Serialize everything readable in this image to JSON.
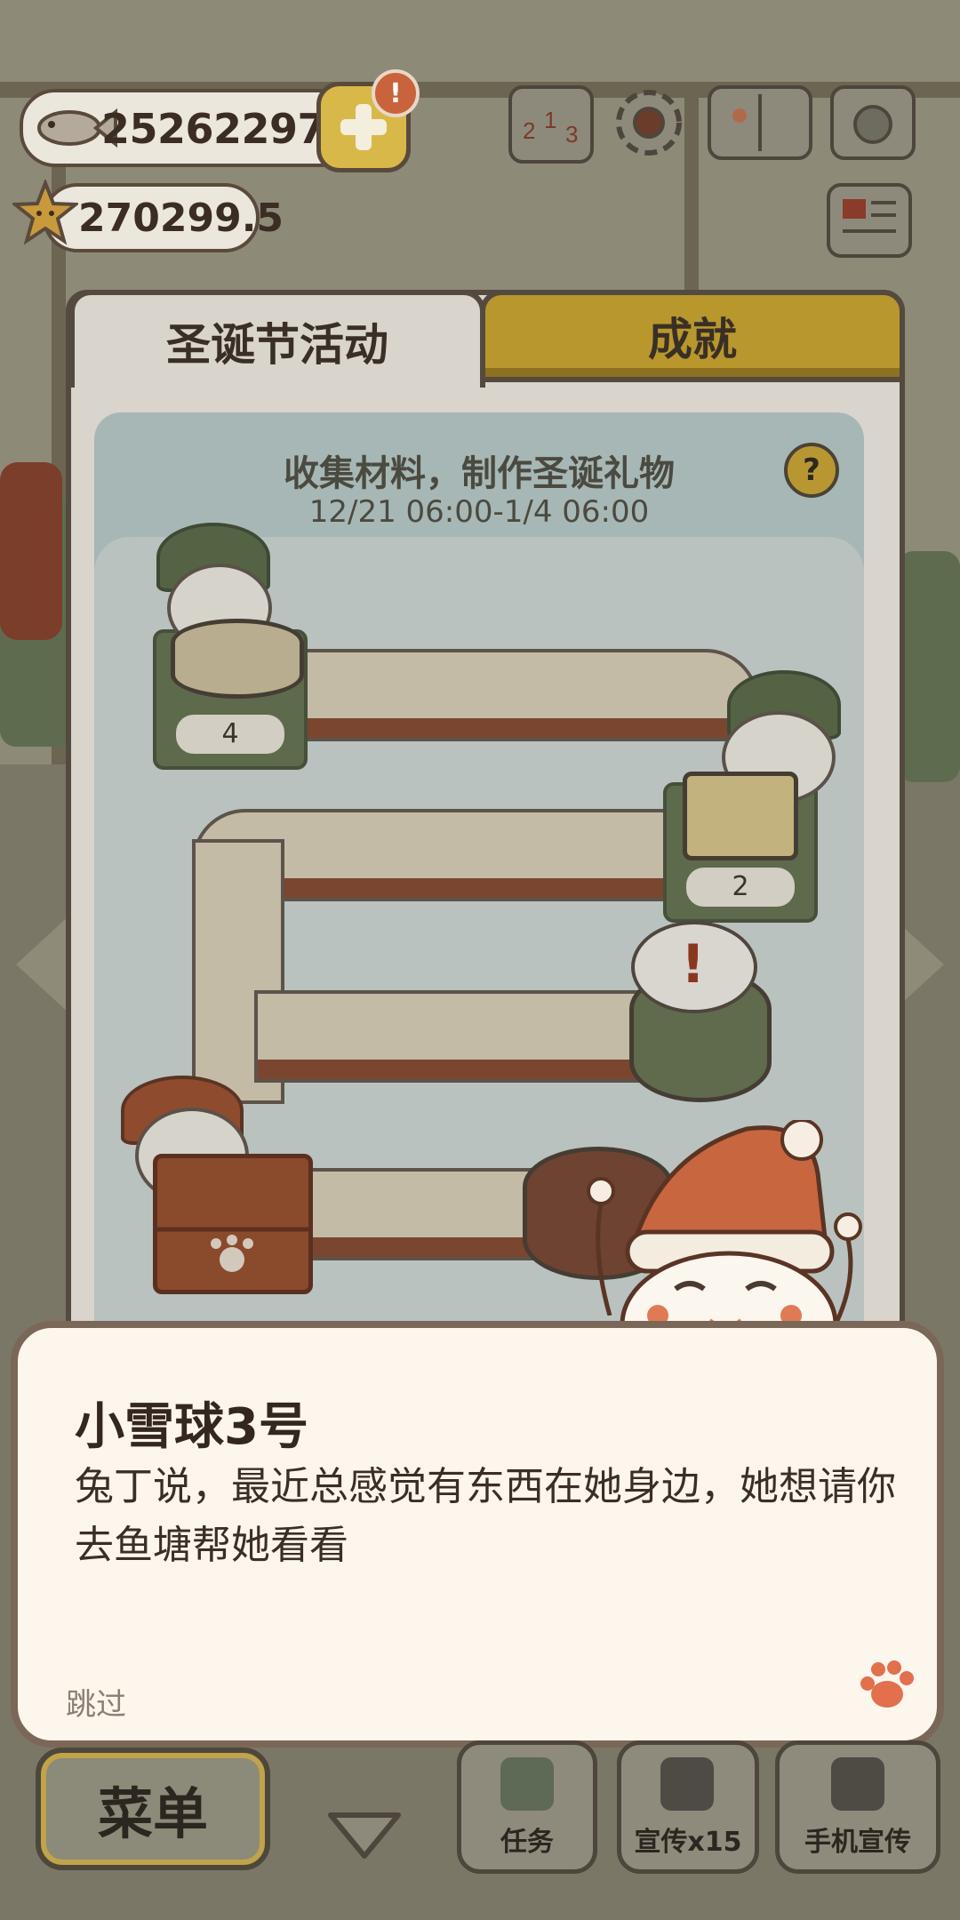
{
  "hud": {
    "fish_amount": "252622971",
    "star_amount": "270299.5",
    "plus_badge": "!"
  },
  "top_icons": [
    "ranking-icon",
    "gear-icon",
    "book-icon",
    "camera-icon",
    "newspaper-icon"
  ],
  "tabs": {
    "active": "圣诞节活动",
    "inactive": "成就"
  },
  "event": {
    "title": "收集材料，制作圣诞礼物",
    "time_range": "12/21 06:00-1/4 06:00",
    "help": "?",
    "station_counts": [
      "4",
      "2"
    ],
    "bubble_mark": "!"
  },
  "dialog": {
    "speaker": "小雪球3号",
    "text": "兔丁说，最近总感觉有东西在她身边，她想请你去鱼塘帮她看看",
    "skip": "跳过"
  },
  "bottom_bar": {
    "menu": "菜单",
    "task": "任务",
    "promo": "宣传x15",
    "phone_promo": "手机宣传"
  },
  "colors": {
    "dialog_bg": "#fdf6ed",
    "tab_inactive": "#b8972c",
    "paw_accent": "#e2704d"
  }
}
